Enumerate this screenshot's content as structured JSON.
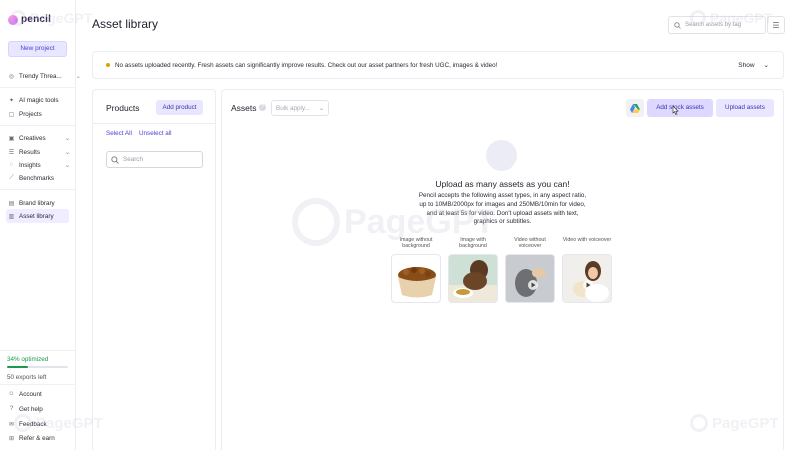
{
  "brand": {
    "name": "pencil"
  },
  "sidebar": {
    "new_project": "New project",
    "workspace": "Trendy Threa...",
    "items": [
      {
        "label": "AI magic tools",
        "icon": "wand-icon"
      },
      {
        "label": "Projects",
        "icon": "folder-icon"
      },
      {
        "label": "Creatives",
        "icon": "image-icon"
      },
      {
        "label": "Results",
        "icon": "list-icon"
      },
      {
        "label": "Insights",
        "icon": "bulb-icon"
      },
      {
        "label": "Benchmarks",
        "icon": "chart-icon"
      },
      {
        "label": "Brand library",
        "icon": "book-icon"
      },
      {
        "label": "Asset library",
        "icon": "library-icon"
      }
    ],
    "optimized": "34% optimized",
    "optimized_fraction": 0.34,
    "exports_left": "50 exports left",
    "bottom": [
      {
        "label": "Account",
        "icon": "user-icon"
      },
      {
        "label": "Get help",
        "icon": "help-icon"
      },
      {
        "label": "Feedback",
        "icon": "feedback-icon"
      },
      {
        "label": "Refer & earn",
        "icon": "gift-icon"
      }
    ]
  },
  "header": {
    "title": "Asset library",
    "search_placeholder": "Search assets by tag"
  },
  "notice": {
    "message": "No assets uploaded recently. Fresh assets can significantly improve results. Check out our asset partners for fresh UGC, images & video!",
    "show_label": "Show"
  },
  "products": {
    "title": "Products",
    "add_button": "Add product",
    "select_all": "Select All",
    "unselect_all": "Unselect all",
    "search_placeholder": "Search"
  },
  "assets": {
    "title": "Assets",
    "bulk_apply_placeholder": "Bulk apply...",
    "add_stock": "Add stock assets",
    "upload": "Upload assets",
    "empty_heading": "Upload as many assets as you can!",
    "empty_desc": "Pencil accepts the following asset types, in any aspect ratio, up to 10MB/2000px for images and 250MB/10min for video, and at least 5s for video. Don't upload assets with text, graphics or subtitles.",
    "examples": [
      {
        "label": "Image without background"
      },
      {
        "label": "Image with background"
      },
      {
        "label": "Video without voiceover"
      },
      {
        "label": "Video with voiceover"
      }
    ]
  },
  "watermark": "PageGPT",
  "colors": {
    "accent": "#4a3fd6",
    "accent_bg": "#e9e6ff",
    "success": "#1a9b4b",
    "notice_dot": "#e0a100"
  }
}
